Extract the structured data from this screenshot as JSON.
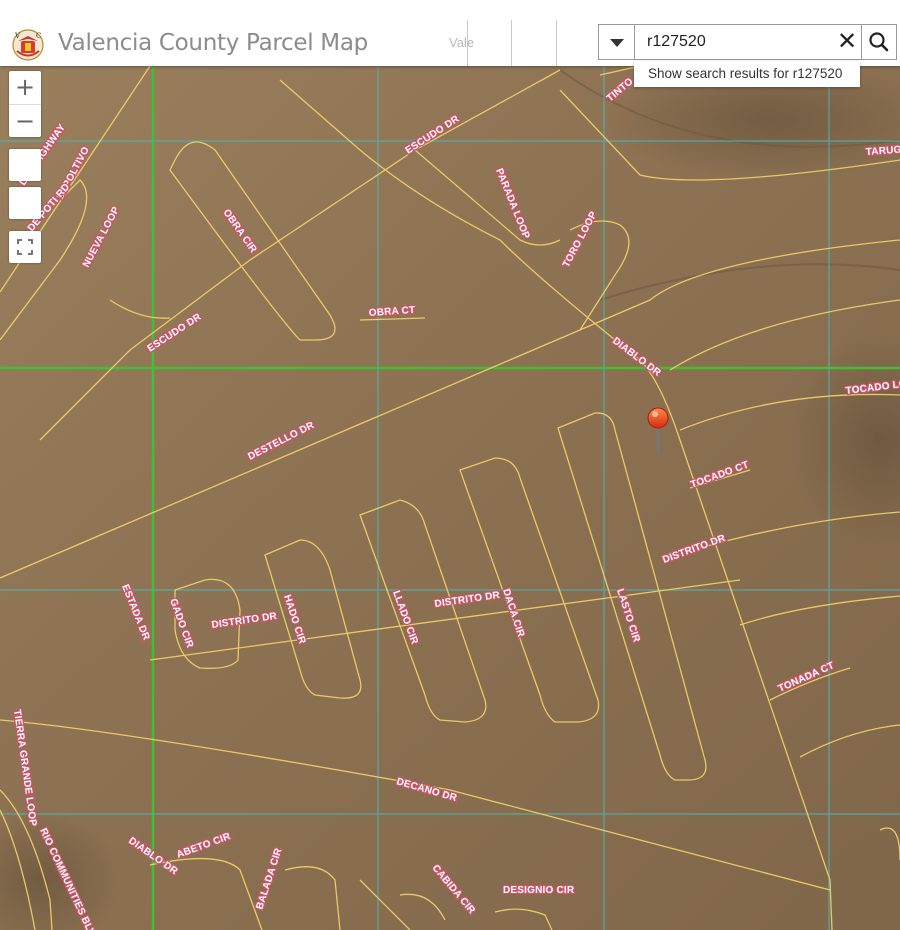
{
  "header": {
    "title": "Valencia County Parcel Map",
    "faded_tab": "Vale"
  },
  "search": {
    "value": "r127520",
    "suggestion": "Show search results for r127520"
  },
  "zoom": {
    "in_label": "+",
    "out_label": "−"
  },
  "map": {
    "streets": [
      "TINTO",
      "ESCUDO DR",
      "TARUG",
      "PARADA LOOP",
      "TORO LOOP",
      "OBRA CIR",
      "OBRA CT",
      "ESCUDO DR",
      "DIABLO DR",
      "TOCADO LO",
      "DESTELLO DR",
      "TOCADO CT",
      "DISTRITO DR",
      "ESTADA DR",
      "GADO CIR",
      "DISTRITO DR",
      "HADO CIR",
      "LLADO CIR",
      "DISTRITO DR",
      "DACA CIR",
      "LASTO CIR",
      "TONADA CT",
      "TIERRA GRANDE LOOP",
      "DECANO DR",
      "DIABLO DR",
      "ABETO CIR",
      "BALADA CIR",
      "CABIDA CIR",
      "DESIGNIO CIR",
      "RIO COMMUNITIES BLVD",
      "NUEVA LOOP",
      "DI POLTIVO",
      "DE POTI RD",
      "LAN HIGHWAY"
    ],
    "marker": "parcel-r127520"
  },
  "colors": {
    "accent_road": "#f1d26a",
    "grid_green": "#3fbf32",
    "grid_teal": "#4fb3b3",
    "marker": "#e8421e"
  }
}
